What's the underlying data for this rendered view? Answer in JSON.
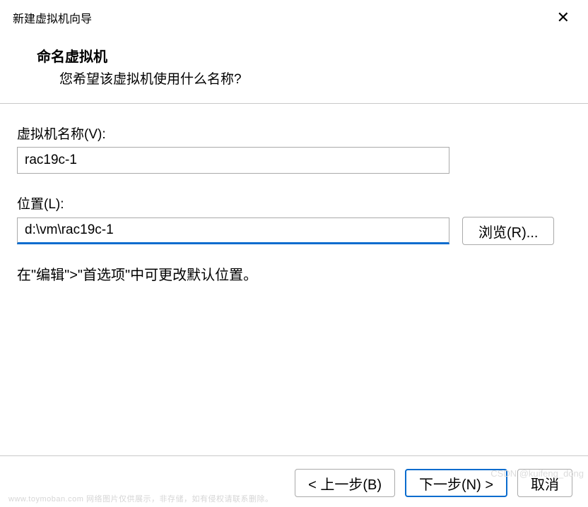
{
  "window": {
    "title": "新建虚拟机向导"
  },
  "header": {
    "title": "命名虚拟机",
    "subtitle": "您希望该虚拟机使用什么名称?"
  },
  "fields": {
    "name": {
      "label": "虚拟机名称(V):",
      "value": "rac19c-1"
    },
    "location": {
      "label": "位置(L):",
      "value": "d:\\vm\\rac19c-1",
      "browse_label": "浏览(R)..."
    },
    "hint": "在\"编辑\">\"首选项\"中可更改默认位置。"
  },
  "footer": {
    "back_label": "< 上一步(B)",
    "next_label": "下一步(N) >",
    "cancel_label": "取消"
  },
  "watermark": {
    "left": "www.toymoban.com 网络图片仅供展示，非存储，如有侵权请联系删除。",
    "right": "CSDN @kuifeng_dong"
  }
}
